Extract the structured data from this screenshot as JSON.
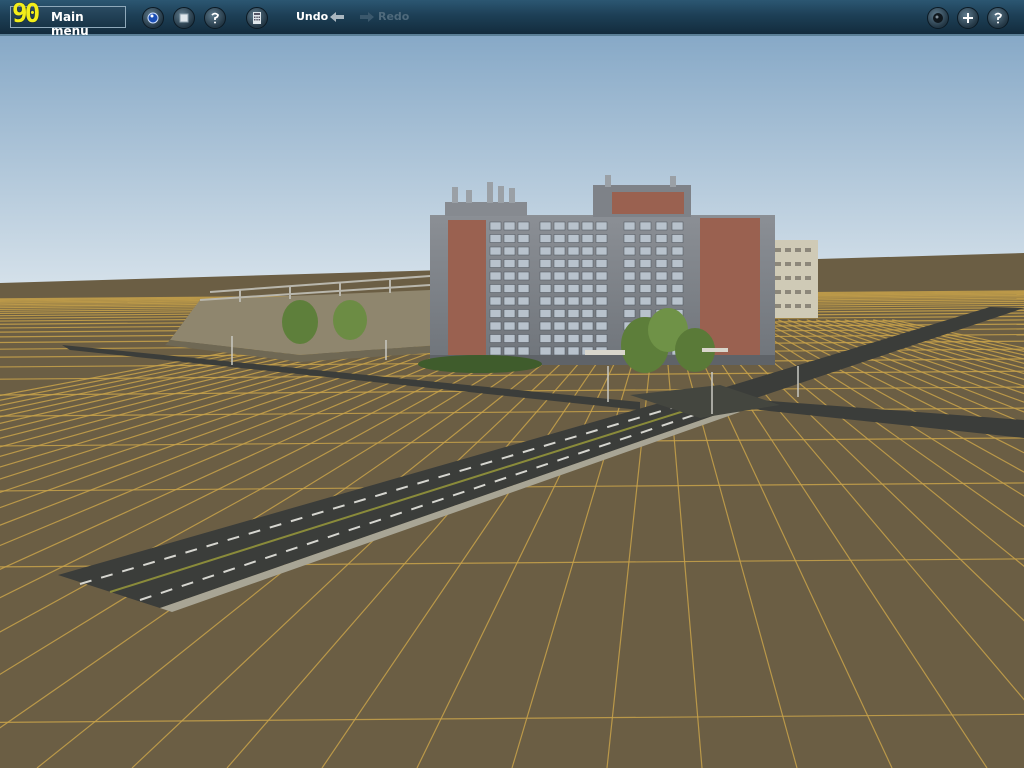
{
  "toolbar": {
    "main_menu_label": "Main menu",
    "fps": "90",
    "undo_label": "Undo",
    "redo_label": "Redo",
    "left_buttons": [
      "camera-icon",
      "stop-icon",
      "help-icon",
      "calculator-icon"
    ],
    "right_buttons": [
      "tool-icon",
      "add-icon",
      "help-icon"
    ]
  },
  "scene": {
    "sky_top": "#87a9c7",
    "sky_bottom": "#d5e1ea",
    "ground": "#6b5e44",
    "grid_line": "#c8a24a",
    "road": "#3b3d3a"
  }
}
